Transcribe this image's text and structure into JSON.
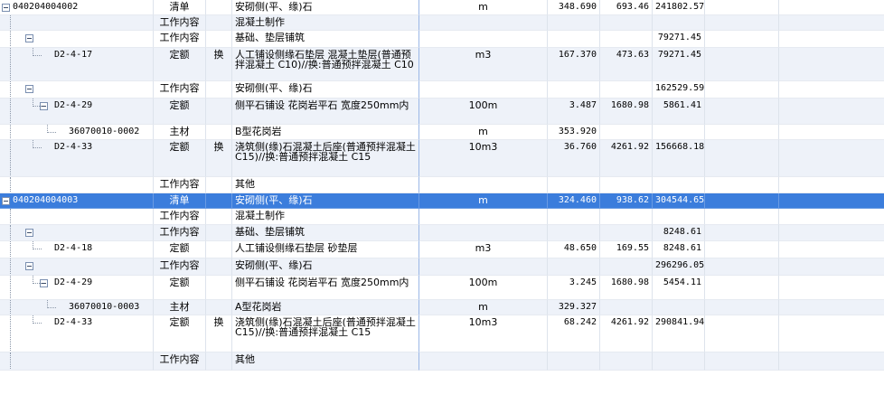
{
  "rows": [
    {
      "code": "040204004002",
      "type": "清单",
      "mark": "",
      "name": "安砌侧(平、缘)石",
      "unit": "m",
      "qty": "348.690",
      "price": "693.46",
      "total": "241802.57",
      "level": 0,
      "toggle": true
    },
    {
      "code": "",
      "type": "工作内容",
      "mark": "",
      "name": "混凝土制作",
      "unit": "",
      "qty": "",
      "price": "",
      "total": "",
      "level": 1,
      "toggle": false
    },
    {
      "code": "",
      "type": "工作内容",
      "mark": "",
      "name": "基础、垫层铺筑",
      "unit": "",
      "qty": "",
      "price": "",
      "total": "79271.45",
      "level": 1,
      "toggle": true
    },
    {
      "code": "D2-4-17",
      "type": "定额",
      "mark": "换",
      "name": "人工铺设侧缘石垫层 混凝土垫层(普通预拌混凝土 C10)//换:普通预拌混凝土 C10",
      "unit": "m3",
      "qty": "167.370",
      "price": "473.63",
      "total": "79271.45",
      "level": 2,
      "toggle": false
    },
    {
      "code": "",
      "type": "工作内容",
      "mark": "",
      "name": "安砌侧(平、缘)石",
      "unit": "",
      "qty": "",
      "price": "",
      "total": "162529.59",
      "level": 1,
      "toggle": true
    },
    {
      "code": "D2-4-29",
      "type": "定额",
      "mark": "",
      "name": "侧平石铺设 花岗岩平石 宽度250mm内",
      "unit": "100m",
      "qty": "3.487",
      "price": "1680.98",
      "total": "5861.41",
      "level": 2,
      "toggle": true
    },
    {
      "code": "36070010-0002",
      "type": "主材",
      "mark": "",
      "name": "B型花岗岩",
      "unit": "m",
      "qty": "353.920",
      "price": "",
      "total": "",
      "level": 3,
      "toggle": false
    },
    {
      "code": "D2-4-33",
      "type": "定额",
      "mark": "换",
      "name": "浇筑侧(缘)石混凝土后座(普通预拌混凝土 C15)//换:普通预拌混凝土 C15",
      "unit": "10m3",
      "qty": "36.760",
      "price": "4261.92",
      "total": "156668.18",
      "level": 2,
      "toggle": false
    },
    {
      "code": "",
      "type": "工作内容",
      "mark": "",
      "name": "其他",
      "unit": "",
      "qty": "",
      "price": "",
      "total": "",
      "level": 1,
      "toggle": false
    },
    {
      "code": "040204004003",
      "type": "清单",
      "mark": "",
      "name": "安砌侧(平、缘)石",
      "unit": "m",
      "qty": "324.460",
      "price": "938.62",
      "total": "304544.65",
      "level": 0,
      "toggle": true,
      "selected": true
    },
    {
      "code": "",
      "type": "工作内容",
      "mark": "",
      "name": "混凝土制作",
      "unit": "",
      "qty": "",
      "price": "",
      "total": "",
      "level": 1,
      "toggle": false
    },
    {
      "code": "",
      "type": "工作内容",
      "mark": "",
      "name": "基础、垫层铺筑",
      "unit": "",
      "qty": "",
      "price": "",
      "total": "8248.61",
      "level": 1,
      "toggle": true
    },
    {
      "code": "D2-4-18",
      "type": "定额",
      "mark": "",
      "name": "人工铺设侧缘石垫层 砂垫层",
      "unit": "m3",
      "qty": "48.650",
      "price": "169.55",
      "total": "8248.61",
      "level": 2,
      "toggle": false
    },
    {
      "code": "",
      "type": "工作内容",
      "mark": "",
      "name": "安砌侧(平、缘)石",
      "unit": "",
      "qty": "",
      "price": "",
      "total": "296296.05",
      "level": 1,
      "toggle": true
    },
    {
      "code": "D2-4-29",
      "type": "定额",
      "mark": "",
      "name": "侧平石铺设 花岗岩平石 宽度250mm内",
      "unit": "100m",
      "qty": "3.245",
      "price": "1680.98",
      "total": "5454.11",
      "level": 2,
      "toggle": true
    },
    {
      "code": "36070010-0003",
      "type": "主材",
      "mark": "",
      "name": "A型花岗岩",
      "unit": "m",
      "qty": "329.327",
      "price": "",
      "total": "",
      "level": 3,
      "toggle": false
    },
    {
      "code": "D2-4-33",
      "type": "定额",
      "mark": "换",
      "name": "浇筑侧(缘)石混凝土后座(普通预拌混凝土 C15)//换:普通预拌混凝土 C15",
      "unit": "10m3",
      "qty": "68.242",
      "price": "4261.92",
      "total": "290841.94",
      "level": 2,
      "toggle": false
    },
    {
      "code": "",
      "type": "工作内容",
      "mark": "",
      "name": "其他",
      "unit": "",
      "qty": "",
      "price": "",
      "total": "",
      "level": 1,
      "toggle": false
    }
  ],
  "colors": {
    "selected": "#3b7ddc",
    "stripe": "#eef2f9"
  }
}
